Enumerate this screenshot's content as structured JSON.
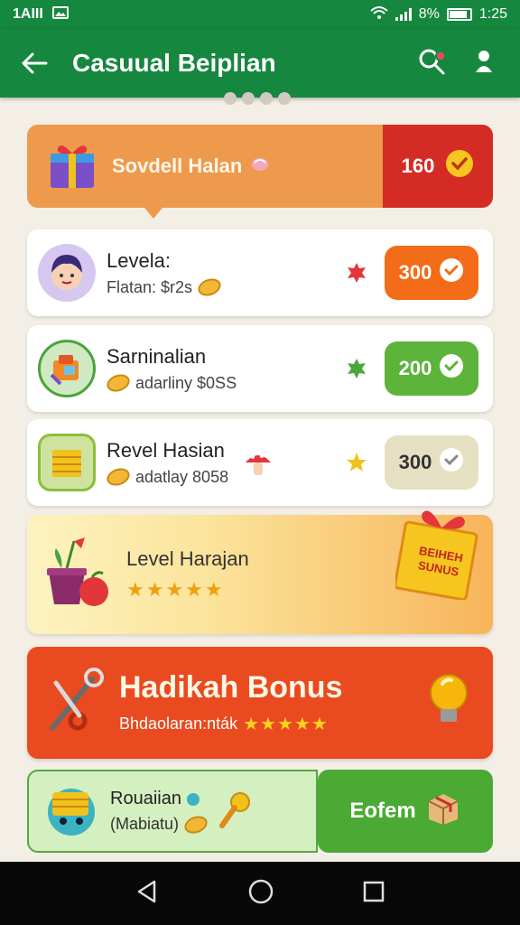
{
  "status": {
    "carrier": "1AIII",
    "battery": "8%",
    "time": "1:25"
  },
  "appbar": {
    "title": "Casuual Beiplian",
    "back_icon": "arrow-left-icon",
    "search_icon": "search-icon",
    "profile_icon": "person-icon"
  },
  "banner_top": {
    "label": "Sovdell Halan",
    "value": "160"
  },
  "rows": [
    {
      "name": "Levela:",
      "sub": "Flatan: $r2s",
      "value": "300",
      "pill_color": "#f36c17",
      "mark_color": "#e2363b"
    },
    {
      "name": "Sarninalian",
      "sub": "adarliny $0SS",
      "value": "200",
      "pill_color": "#5cb43a",
      "mark_color": "#49a83b"
    },
    {
      "name": "Revel Hasian",
      "sub": "adatlay 8058",
      "value": "300",
      "pill_color": "#e6e0c2",
      "mark_color": "#f2c21c"
    }
  ],
  "level_banner": {
    "title": "Level Harajan",
    "stars": "★★★★★",
    "tag_line1": "BEIHEH",
    "tag_line2": "SUNUS"
  },
  "bonus_banner": {
    "title": "Hadikah Bonus",
    "sub": "Bhdaolaran:nták",
    "stars": "★★★★★"
  },
  "bottom": {
    "name": "Rouaiian",
    "sub": "(Mabiatu)",
    "button_label": "Eofem"
  },
  "nav": {
    "back": "back-icon",
    "home": "home-icon",
    "recents": "recents-icon"
  },
  "colors": {
    "primary": "#16873f",
    "orange": "#ee9a4c",
    "red": "#d52b25",
    "bonus": "#ea4a1f",
    "green_btn": "#4aaa33"
  }
}
